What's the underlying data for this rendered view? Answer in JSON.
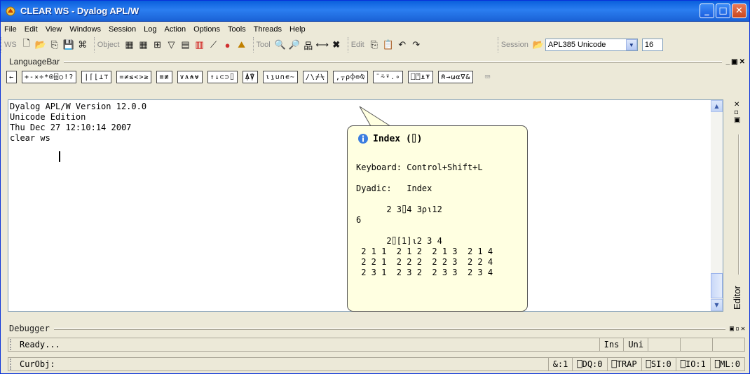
{
  "window": {
    "title": "CLEAR WS - Dyalog APL/W",
    "buttons": {
      "minimize": "_",
      "maximize": "□",
      "close": "✕"
    }
  },
  "menu": [
    "File",
    "Edit",
    "View",
    "Windows",
    "Session",
    "Log",
    "Action",
    "Options",
    "Tools",
    "Threads",
    "Help"
  ],
  "toolbar": {
    "ws_label": "WS",
    "object_label": "Object",
    "tool_label": "Tool",
    "edit_label": "Edit",
    "session_label": "Session",
    "font_combo": "APL385 Unicode",
    "size_combo": "16"
  },
  "language_bar": {
    "title": "LanguageBar",
    "groups": [
      "←",
      "+-×÷*⍟⌹○!?",
      "|⌈⌊⊥⊤",
      "=≠≤<>≥",
      "≡≢",
      "∨∧⍲⍱",
      "↑↓⊂⊃⌷",
      "⍋⍒",
      "⍳⍸∪∩∊~",
      "/\\⌿⍀",
      ",⍪⍴⌽⊖⍉",
      "¨⍨⍣.∘",
      "⎕⍞⍎⍕",
      "⍝→⍵⍺∇&"
    ]
  },
  "session": {
    "lines": [
      "Dyalog APL/W Version 12.0.0",
      "Unicode Edition",
      "Thu Dec 27 12:10:14 2007",
      "clear ws"
    ]
  },
  "tooltip": {
    "title": "Index (⌷)",
    "body": "Keyboard: Control+Shift+L\n\nDyadic:   Index\n\n      2 3⌷4 3⍴⍳12\n6\n\n      2⌷[1]⍳2 3 4\n 2 1 1  2 1 2  2 1 3  2 1 4\n 2 2 1  2 2 2  2 2 3  2 2 4\n 2 3 1  2 3 2  2 3 3  2 3 4"
  },
  "editor_tab": "Editor",
  "debugger": {
    "title": "Debugger"
  },
  "status1": {
    "message": "Ready...",
    "ins": "Ins",
    "uni": "Uni"
  },
  "status2": {
    "curobj": "CurObj:",
    "pos": "&:1",
    "dq": "⎕DQ:0",
    "trap": "⎕TRAP",
    "si": "⎕SI:0",
    "io": "⎕IO:1",
    "ml": "⎕ML:0"
  }
}
